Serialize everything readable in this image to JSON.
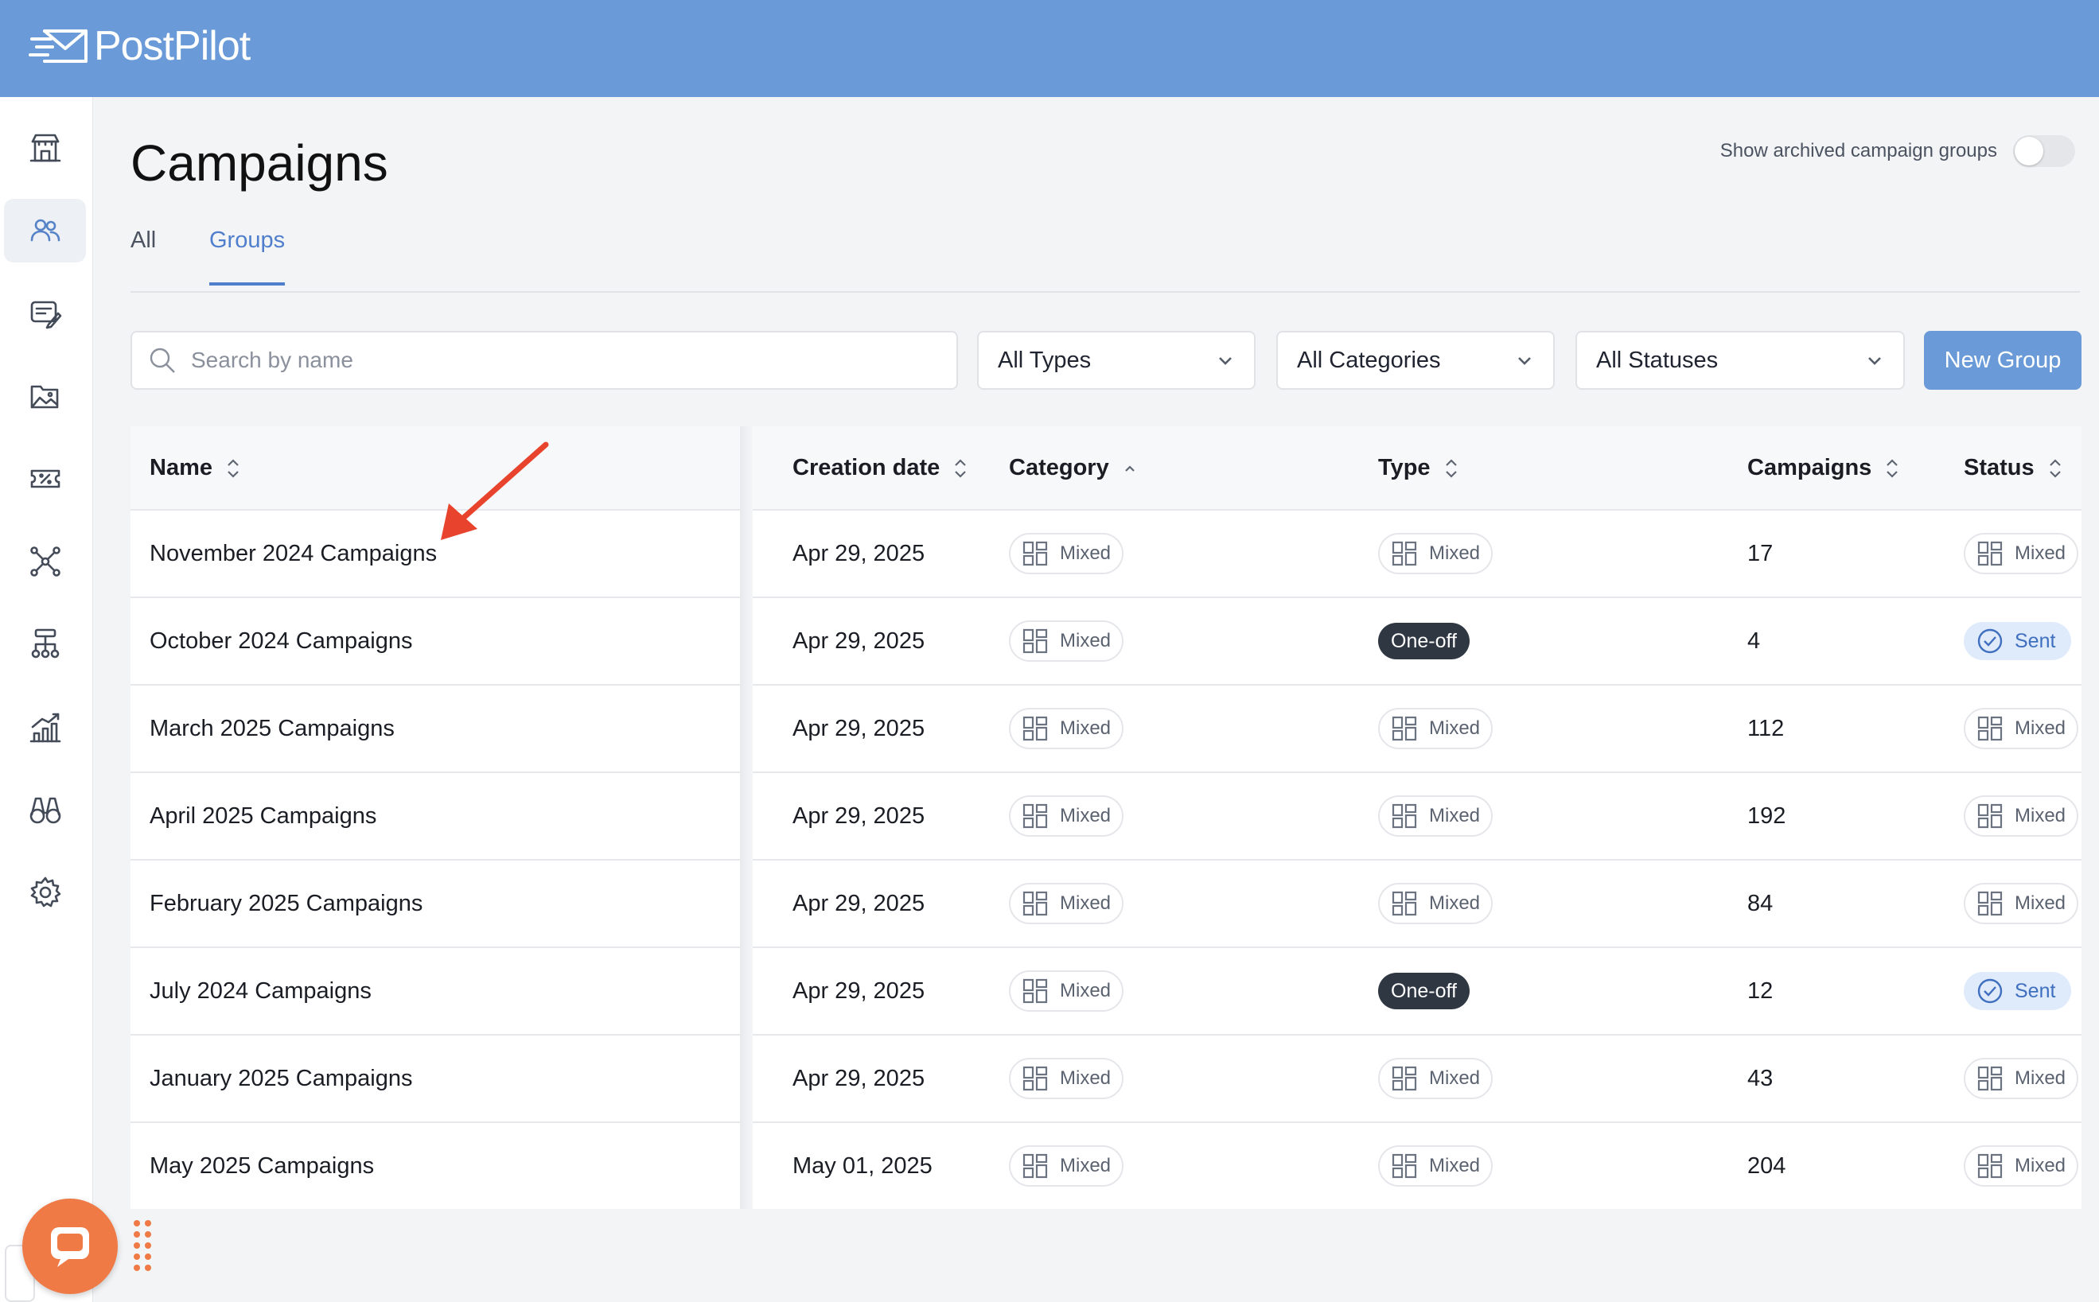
{
  "app": {
    "name": "PostPilot"
  },
  "sidebar": {
    "items": [
      {
        "icon": "storefront-icon",
        "active": false
      },
      {
        "icon": "users-icon",
        "active": true
      },
      {
        "icon": "creative-icon",
        "active": false
      },
      {
        "icon": "gallery-icon",
        "active": false
      },
      {
        "icon": "ticket-percent-icon",
        "active": false
      },
      {
        "icon": "network-icon",
        "active": false
      },
      {
        "icon": "hierarchy-icon",
        "active": false
      },
      {
        "icon": "analytics-icon",
        "active": false
      },
      {
        "icon": "binoculars-icon",
        "active": false
      },
      {
        "icon": "settings-icon",
        "active": false
      }
    ]
  },
  "page": {
    "title": "Campaigns"
  },
  "archived": {
    "label": "Show archived campaign groups",
    "on": false
  },
  "tabs": [
    {
      "label": "All"
    },
    {
      "label": "Groups"
    }
  ],
  "filters": {
    "search_placeholder": "Search by name",
    "types": "All Types",
    "categories": "All Categories",
    "statuses": "All Statuses",
    "new_group": "New Group"
  },
  "table": {
    "headers": {
      "name": "Name",
      "date": "Creation date",
      "category": "Category",
      "type": "Type",
      "campaigns": "Campaigns",
      "status": "Status"
    },
    "rows": [
      {
        "name": "November 2024 Campaigns",
        "date": "Apr 29, 2025",
        "category": "Mixed",
        "type": "Mixed",
        "campaigns": "17",
        "status": "Mixed"
      },
      {
        "name": "October 2024 Campaigns",
        "date": "Apr 29, 2025",
        "category": "Mixed",
        "type": "One-off",
        "campaigns": "4",
        "status": "Sent"
      },
      {
        "name": "March 2025 Campaigns",
        "date": "Apr 29, 2025",
        "category": "Mixed",
        "type": "Mixed",
        "campaigns": "112",
        "status": "Mixed"
      },
      {
        "name": "April 2025 Campaigns",
        "date": "Apr 29, 2025",
        "category": "Mixed",
        "type": "Mixed",
        "campaigns": "192",
        "status": "Mixed"
      },
      {
        "name": "February 2025 Campaigns",
        "date": "Apr 29, 2025",
        "category": "Mixed",
        "type": "Mixed",
        "campaigns": "84",
        "status": "Mixed"
      },
      {
        "name": "July 2024 Campaigns",
        "date": "Apr 29, 2025",
        "category": "Mixed",
        "type": "One-off",
        "campaigns": "12",
        "status": "Sent"
      },
      {
        "name": "January 2025 Campaigns",
        "date": "Apr 29, 2025",
        "category": "Mixed",
        "type": "Mixed",
        "campaigns": "43",
        "status": "Mixed"
      },
      {
        "name": "May 2025 Campaigns",
        "date": "May 01, 2025",
        "category": "Mixed",
        "type": "Mixed",
        "campaigns": "204",
        "status": "Mixed"
      }
    ]
  },
  "colors": {
    "brand": "#6a9bd8",
    "accent": "#4f7fcc",
    "chat": "#ef7a45",
    "arrow": "#e8432c"
  }
}
